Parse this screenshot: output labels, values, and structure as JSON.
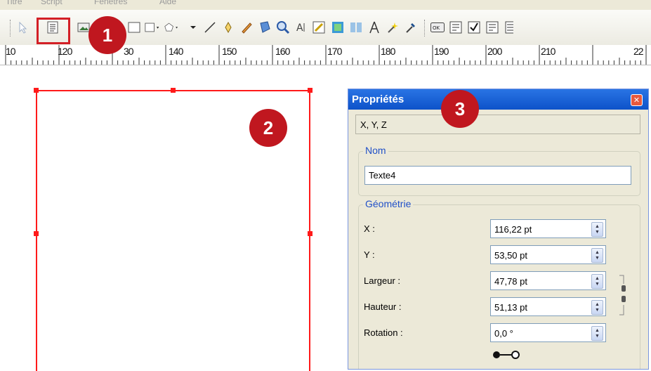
{
  "menu": {
    "items": [
      "Titre",
      "Script",
      "Fenêtres",
      "Aide"
    ]
  },
  "toolbar": {
    "icons": [
      "select-icon",
      "text-frame-icon",
      "image-frame-icon",
      "table-icon",
      "shape-icon",
      "polygon-icon",
      "line-icon",
      "bezier-icon",
      "freehand-icon",
      "rotate-icon",
      "zoom-icon",
      "edit-text-icon",
      "link-frames-icon",
      "unlink-frames-icon",
      "measure-icon",
      "copy-properties-icon",
      "eyedropper-icon",
      "pdf-button-icon",
      "pdf-textfield-icon",
      "pdf-checkbox-icon",
      "pdf-combobox-icon",
      "pdf-listbox-icon"
    ]
  },
  "ruler": {
    "labels": [
      "10",
      "120",
      "30",
      "140",
      "150",
      "160",
      "170",
      "180",
      "190",
      "200",
      "210",
      "22"
    ]
  },
  "badges": {
    "one": "1",
    "two": "2",
    "three": "3"
  },
  "panel": {
    "title": "Propriétés",
    "close": "✕",
    "tab": "X, Y, Z",
    "name_group": "Nom",
    "name_value": "Texte4",
    "geometry_group": "Géométrie",
    "fields": [
      {
        "label": "X :",
        "value": "116,22 pt"
      },
      {
        "label": "Y :",
        "value": "53,50 pt"
      },
      {
        "label": "Largeur :",
        "value": "47,78 pt"
      },
      {
        "label": "Hauteur :",
        "value": "51,13 pt"
      },
      {
        "label": "Rotation :",
        "value": "0,0 °"
      }
    ]
  },
  "colors": {
    "highlight": "#d31f26",
    "badge": "#c0171f",
    "frame": "#ff1a1a",
    "title_bar": "#0d52c9",
    "group_title": "#2050c8"
  }
}
